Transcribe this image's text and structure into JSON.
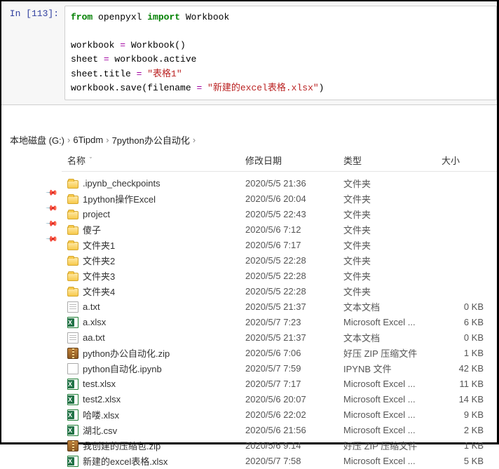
{
  "prompt": "In [113]:",
  "code": {
    "l1_kw1": "from",
    "l1_mod": " openpyxl ",
    "l1_kw2": "import",
    "l1_cls": " Workbook",
    "l2": "",
    "l3_a": "workbook ",
    "l3_op": "=",
    "l3_b": " Workbook()",
    "l4_a": "sheet ",
    "l4_op": "=",
    "l4_b": " workbook.active",
    "l5_a": "sheet.title ",
    "l5_op": "=",
    "l5_str": " \"表格1\"",
    "l6_a": "workbook.save(filename ",
    "l6_op": "=",
    "l6_str": " \"新建的excel表格.xlsx\"",
    "l6_b": ")"
  },
  "breadcrumb": {
    "seg1": "本地磁盘 (G:)",
    "seg2": "6Tipdm",
    "seg3": "7python办公自动化",
    "sep": "›"
  },
  "columns": {
    "name": "名称",
    "date": "修改日期",
    "type": "类型",
    "size": "大小",
    "caret": "ˇ"
  },
  "files": [
    {
      "icon": "folder",
      "name": ".ipynb_checkpoints",
      "date": "2020/5/5 21:36",
      "type": "文件夹",
      "size": ""
    },
    {
      "icon": "folder",
      "name": "1python操作Excel",
      "date": "2020/5/6 20:04",
      "type": "文件夹",
      "size": ""
    },
    {
      "icon": "folder",
      "name": "project",
      "date": "2020/5/5 22:43",
      "type": "文件夹",
      "size": ""
    },
    {
      "icon": "folder",
      "name": "傻子",
      "date": "2020/5/6 7:12",
      "type": "文件夹",
      "size": ""
    },
    {
      "icon": "folder",
      "name": "文件夹1",
      "date": "2020/5/6 7:17",
      "type": "文件夹",
      "size": ""
    },
    {
      "icon": "folder",
      "name": "文件夹2",
      "date": "2020/5/5 22:28",
      "type": "文件夹",
      "size": ""
    },
    {
      "icon": "folder",
      "name": "文件夹3",
      "date": "2020/5/5 22:28",
      "type": "文件夹",
      "size": ""
    },
    {
      "icon": "folder",
      "name": "文件夹4",
      "date": "2020/5/5 22:28",
      "type": "文件夹",
      "size": ""
    },
    {
      "icon": "txt",
      "name": "a.txt",
      "date": "2020/5/5 21:37",
      "type": "文本文档",
      "size": "0 KB"
    },
    {
      "icon": "xlsx",
      "name": "a.xlsx",
      "date": "2020/5/7 7:23",
      "type": "Microsoft Excel ...",
      "size": "6 KB"
    },
    {
      "icon": "txt",
      "name": "aa.txt",
      "date": "2020/5/5 21:37",
      "type": "文本文档",
      "size": "0 KB"
    },
    {
      "icon": "zip",
      "name": "python办公自动化.zip",
      "date": "2020/5/6 7:06",
      "type": "好压 ZIP 压缩文件",
      "size": "1 KB"
    },
    {
      "icon": "ipynb",
      "name": "python自动化.ipynb",
      "date": "2020/5/7 7:59",
      "type": "IPYNB 文件",
      "size": "42 KB"
    },
    {
      "icon": "xlsx",
      "name": "test.xlsx",
      "date": "2020/5/7 7:17",
      "type": "Microsoft Excel ...",
      "size": "11 KB"
    },
    {
      "icon": "xlsx",
      "name": "test2.xlsx",
      "date": "2020/5/6 20:07",
      "type": "Microsoft Excel ...",
      "size": "14 KB"
    },
    {
      "icon": "xlsx",
      "name": "哈喽.xlsx",
      "date": "2020/5/6 22:02",
      "type": "Microsoft Excel ...",
      "size": "9 KB"
    },
    {
      "icon": "xlsx",
      "name": "湖北.csv",
      "date": "2020/5/6 21:56",
      "type": "Microsoft Excel ...",
      "size": "2 KB"
    },
    {
      "icon": "zip",
      "name": "我创建的压缩包.zip",
      "date": "2020/5/6 9:14",
      "type": "好压 ZIP 压缩文件",
      "size": "1 KB"
    },
    {
      "icon": "xlsx",
      "name": "新建的excel表格.xlsx",
      "date": "2020/5/7 7:58",
      "type": "Microsoft Excel ...",
      "size": "5 KB"
    }
  ],
  "pins": 4
}
